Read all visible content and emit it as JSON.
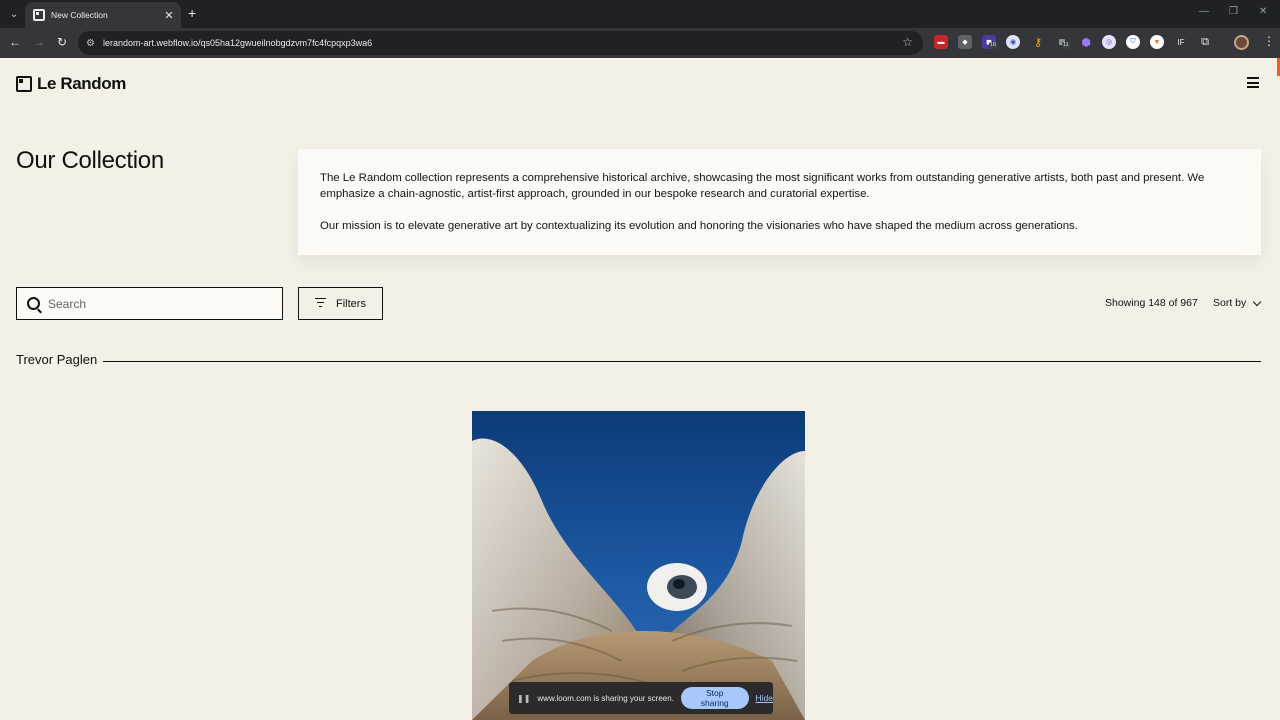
{
  "browser": {
    "tab_title": "New Collection",
    "url": "lerandom-art.webflow.io/qs05ha12gwueilnobgdzvm7fc4fcpqxp3wa6",
    "extension_badges": [
      "16",
      "11"
    ],
    "extension_label": "IF"
  },
  "site": {
    "logo_text": "Le Random"
  },
  "collection": {
    "title": "Our Collection",
    "intro_p1": "The Le Random collection represents a comprehensive historical archive, showcasing the most significant works from outstanding generative artists, both past and present. We emphasize a chain-agnostic, artist-first approach, grounded in our bespoke research and curatorial expertise.",
    "intro_p2": "Our mission is to elevate generative art by contextualizing its evolution and honoring the visionaries who have shaped the medium across generations."
  },
  "controls": {
    "search_placeholder": "Search",
    "filters_label": "Filters",
    "showing_text": "Showing 148 of 967",
    "sort_label": "Sort by"
  },
  "artist_section": {
    "name": "Trevor Paglen"
  },
  "share_bar": {
    "message": "www.loom.com is sharing your screen.",
    "stop_label": "Stop sharing",
    "hide_label": "Hide"
  },
  "colors": {
    "page_bg": "#f3f0e6",
    "card_bg": "#fbfaf5",
    "chrome_dark": "#202124",
    "chrome_toolbar": "#35363a",
    "accent_orange": "#f25c1f",
    "stop_button": "#a8c7fa"
  }
}
